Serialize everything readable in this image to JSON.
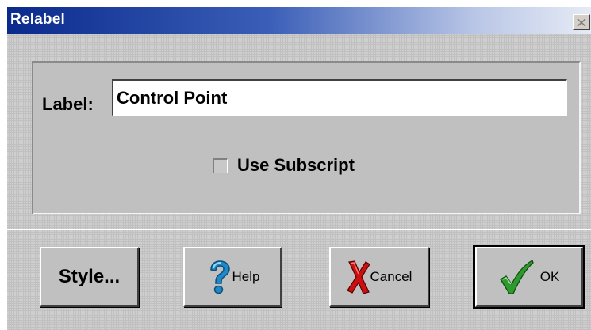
{
  "window": {
    "title": "Relabel"
  },
  "form": {
    "label_caption": "Label:",
    "label_value": "Control Point",
    "subscript_caption": "Use Subscript",
    "subscript_checked": false
  },
  "buttons": {
    "style_label": "Style...",
    "help_label": "Help",
    "cancel_label": "Cancel",
    "ok_label": "OK"
  },
  "icons": {
    "close": "close-icon",
    "help": "question-mark-icon",
    "cancel": "red-x-icon",
    "ok": "green-checkmark-icon"
  },
  "colors": {
    "title_bar_start": "#0a2a8c",
    "dialog_face": "#c0c0c0",
    "help_icon": "#1e88c8",
    "cancel_icon": "#cc1010",
    "ok_icon": "#2e9a2e"
  }
}
